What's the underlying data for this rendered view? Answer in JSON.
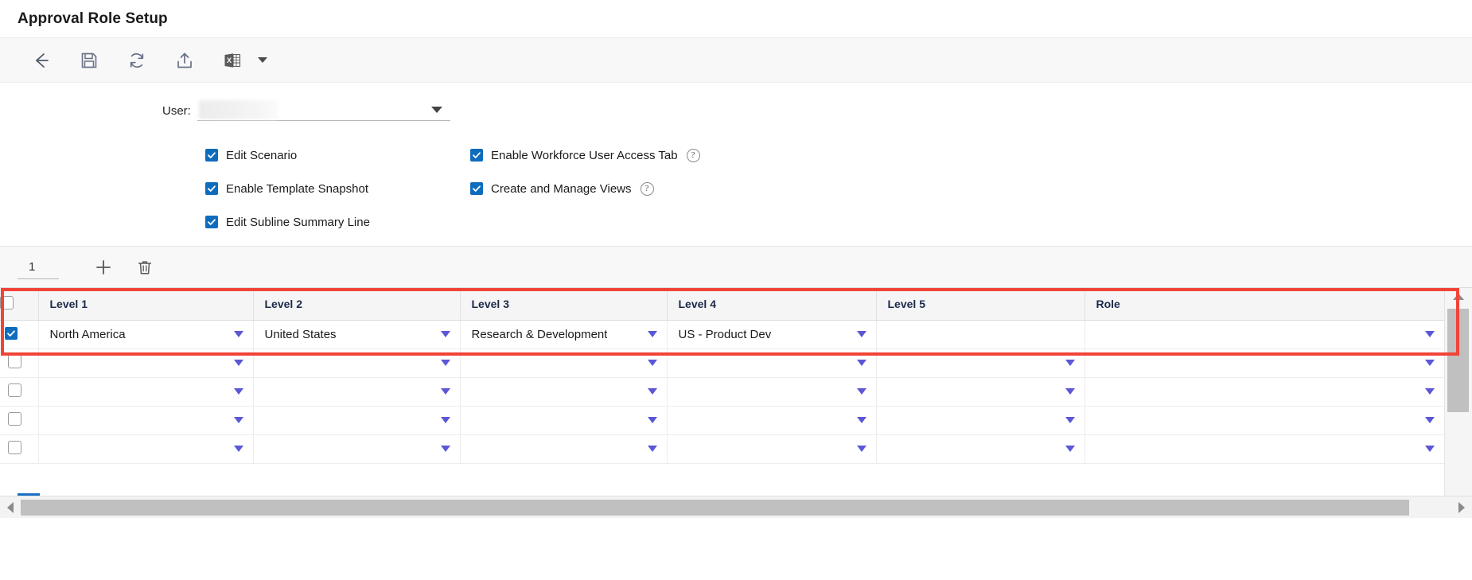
{
  "window": {
    "title": "Approval Role Setup"
  },
  "toolbar": {
    "buttons": [
      {
        "name": "back-icon",
        "label": "Back"
      },
      {
        "name": "save-icon",
        "label": "Save"
      },
      {
        "name": "refresh-icon",
        "label": "Refresh"
      },
      {
        "name": "upload-icon",
        "label": "Upload"
      },
      {
        "name": "excel-icon",
        "label": "Export to Excel"
      }
    ],
    "excel_caret": "chevron-down-icon"
  },
  "form": {
    "user_label": "User:",
    "user_value": "",
    "user_placeholder": "",
    "user_redacted": true,
    "checkboxes_left": [
      {
        "label": "Edit Scenario",
        "checked": true,
        "help": false
      },
      {
        "label": "Enable Template Snapshot",
        "checked": true,
        "help": false
      },
      {
        "label": "Edit Subline Summary Line",
        "checked": true,
        "help": false
      }
    ],
    "checkboxes_right": [
      {
        "label": "Enable Workforce User Access Tab",
        "checked": true,
        "help": true,
        "help_glyph": "?"
      },
      {
        "label": "Create and Manage Views",
        "checked": true,
        "help": true,
        "help_glyph": "?"
      }
    ]
  },
  "grid_toolbar": {
    "row_count": "1",
    "add_label": "Add row",
    "delete_label": "Delete row"
  },
  "grid": {
    "columns": [
      "Level 1",
      "Level 2",
      "Level 3",
      "Level 4",
      "Level 5",
      "Role"
    ],
    "header_select_all_checked": false,
    "rows": [
      {
        "selected": true,
        "highlighted": true,
        "cells": [
          {
            "value": "North America",
            "caret": true
          },
          {
            "value": "United States",
            "caret": true
          },
          {
            "value": "Research & Development",
            "caret": true
          },
          {
            "value": "US - Product Dev",
            "caret": true
          },
          {
            "value": "",
            "caret": false
          },
          {
            "value": "",
            "caret": true
          }
        ]
      },
      {
        "selected": false,
        "highlighted": false,
        "cells": [
          {
            "value": "",
            "caret": true
          },
          {
            "value": "",
            "caret": true
          },
          {
            "value": "",
            "caret": true
          },
          {
            "value": "",
            "caret": true
          },
          {
            "value": "",
            "caret": true
          },
          {
            "value": "",
            "caret": true
          }
        ]
      },
      {
        "selected": false,
        "highlighted": false,
        "cells": [
          {
            "value": "",
            "caret": true
          },
          {
            "value": "",
            "caret": true
          },
          {
            "value": "",
            "caret": true
          },
          {
            "value": "",
            "caret": true
          },
          {
            "value": "",
            "caret": true
          },
          {
            "value": "",
            "caret": true
          }
        ]
      },
      {
        "selected": false,
        "highlighted": false,
        "cells": [
          {
            "value": "",
            "caret": true
          },
          {
            "value": "",
            "caret": true
          },
          {
            "value": "",
            "caret": true
          },
          {
            "value": "",
            "caret": true
          },
          {
            "value": "",
            "caret": true
          },
          {
            "value": "",
            "caret": true
          }
        ]
      },
      {
        "selected": false,
        "highlighted": false,
        "cells": [
          {
            "value": "",
            "caret": true
          },
          {
            "value": "",
            "caret": true
          },
          {
            "value": "",
            "caret": true
          },
          {
            "value": "",
            "caret": true
          },
          {
            "value": "",
            "caret": true
          },
          {
            "value": "",
            "caret": true
          }
        ]
      }
    ]
  },
  "colors": {
    "checkbox_accent": "#0f6cbd",
    "highlight_border": "#f04438",
    "cell_caret": "#5b57d6",
    "header_text": "#1b2a4a"
  }
}
